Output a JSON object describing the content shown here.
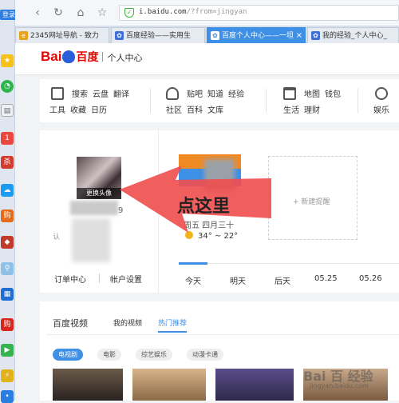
{
  "dock": {
    "login_label": "登录"
  },
  "browser": {
    "url_host": "i.baidu.com",
    "url_rest": "/?from=jingyan",
    "tabs": [
      {
        "label": "2345网址导航 - 致力"
      },
      {
        "label": "百度经验——实用生"
      },
      {
        "label": "百度个人中心——一坦"
      },
      {
        "label": "我的经验_个人中心_"
      }
    ]
  },
  "header": {
    "logo_bai": "Bai",
    "logo_du": "百度",
    "subtitle": "个人中心"
  },
  "services": {
    "group1": {
      "row1": [
        "搜索",
        "云盘",
        "翻译"
      ],
      "row2": [
        "工具",
        "收藏",
        "日历"
      ]
    },
    "group2": {
      "row1": [
        "贴吧",
        "知道",
        "经验"
      ],
      "row2": [
        "社区",
        "百科",
        "文库"
      ]
    },
    "group3": {
      "row1": [
        "地图",
        "钱包"
      ],
      "row2": [
        "生活",
        "理财"
      ]
    },
    "group4": {
      "label": "娱乐"
    }
  },
  "profile": {
    "change_avatar": "更换头像",
    "num_label": "9",
    "ren_label": "认",
    "order_center": "订单中心",
    "account_settings": "帐户设置",
    "weather_place": "周五  四月三十",
    "weather_temp": "34° ~ 22°",
    "new_reminder": "+ 新建提醒",
    "day_tabs": [
      "今天",
      "明天",
      "后天",
      "05.25",
      "05.26"
    ],
    "callout": "点这里"
  },
  "video": {
    "title": "百度视频",
    "tab_mine": "我的视频",
    "tab_hot": "热门推荐",
    "chips": [
      "电视剧",
      "电影",
      "综艺娱乐",
      "动漫卡通"
    ],
    "watermark": "Bai 百 经验",
    "watermark_url": "jingyan.baidu.com"
  }
}
